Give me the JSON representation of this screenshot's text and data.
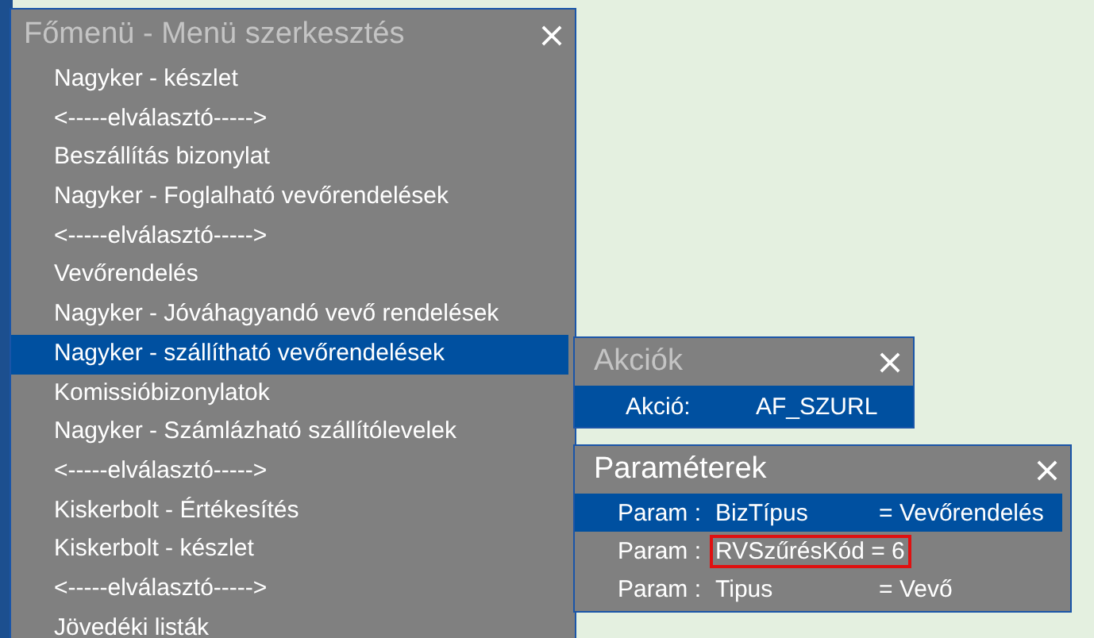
{
  "main_menu": {
    "title": "Főmenü - Menü szerkesztés",
    "active": false,
    "items": [
      {
        "label": "Nagyker - készlet",
        "selected": false
      },
      {
        "label": "<-----elválasztó----->",
        "selected": false
      },
      {
        "label": "Beszállítás bizonylat",
        "selected": false
      },
      {
        "label": "Nagyker - Foglalható vevőrendelések",
        "selected": false
      },
      {
        "label": "<-----elválasztó----->",
        "selected": false
      },
      {
        "label": "Vevőrendelés",
        "selected": false
      },
      {
        "label": "Nagyker - Jóváhagyandó vevő rendelések",
        "selected": false
      },
      {
        "label": "Nagyker - szállítható vevőrendelések",
        "selected": true
      },
      {
        "label": "Komissióbizonylatok",
        "selected": false
      },
      {
        "label": "Nagyker - Számlázható szállítólevelek",
        "selected": false
      },
      {
        "label": "<-----elválasztó----->",
        "selected": false
      },
      {
        "label": "Kiskerbolt - Értékesítés",
        "selected": false
      },
      {
        "label": "Kiskerbolt - készlet",
        "selected": false
      },
      {
        "label": "<-----elválasztó----->",
        "selected": false
      },
      {
        "label": "Jövedéki listák",
        "selected": false
      }
    ]
  },
  "actions": {
    "title": "Akciók",
    "active": false,
    "label": "Akció:",
    "value": "AF_SZURL"
  },
  "parameters": {
    "title": "Paraméterek",
    "active": true,
    "rows": [
      {
        "label": "Param :",
        "key": "BizTípus",
        "value": "= Vevőrendelés",
        "selected": true,
        "highlighted": false
      },
      {
        "label": "Param :",
        "key": "RVSzűrésKód = 6",
        "selected": false,
        "highlighted": true
      },
      {
        "label": "Param :",
        "key": "Tipus",
        "value": "= Vevő",
        "selected": false,
        "highlighted": false
      }
    ]
  }
}
